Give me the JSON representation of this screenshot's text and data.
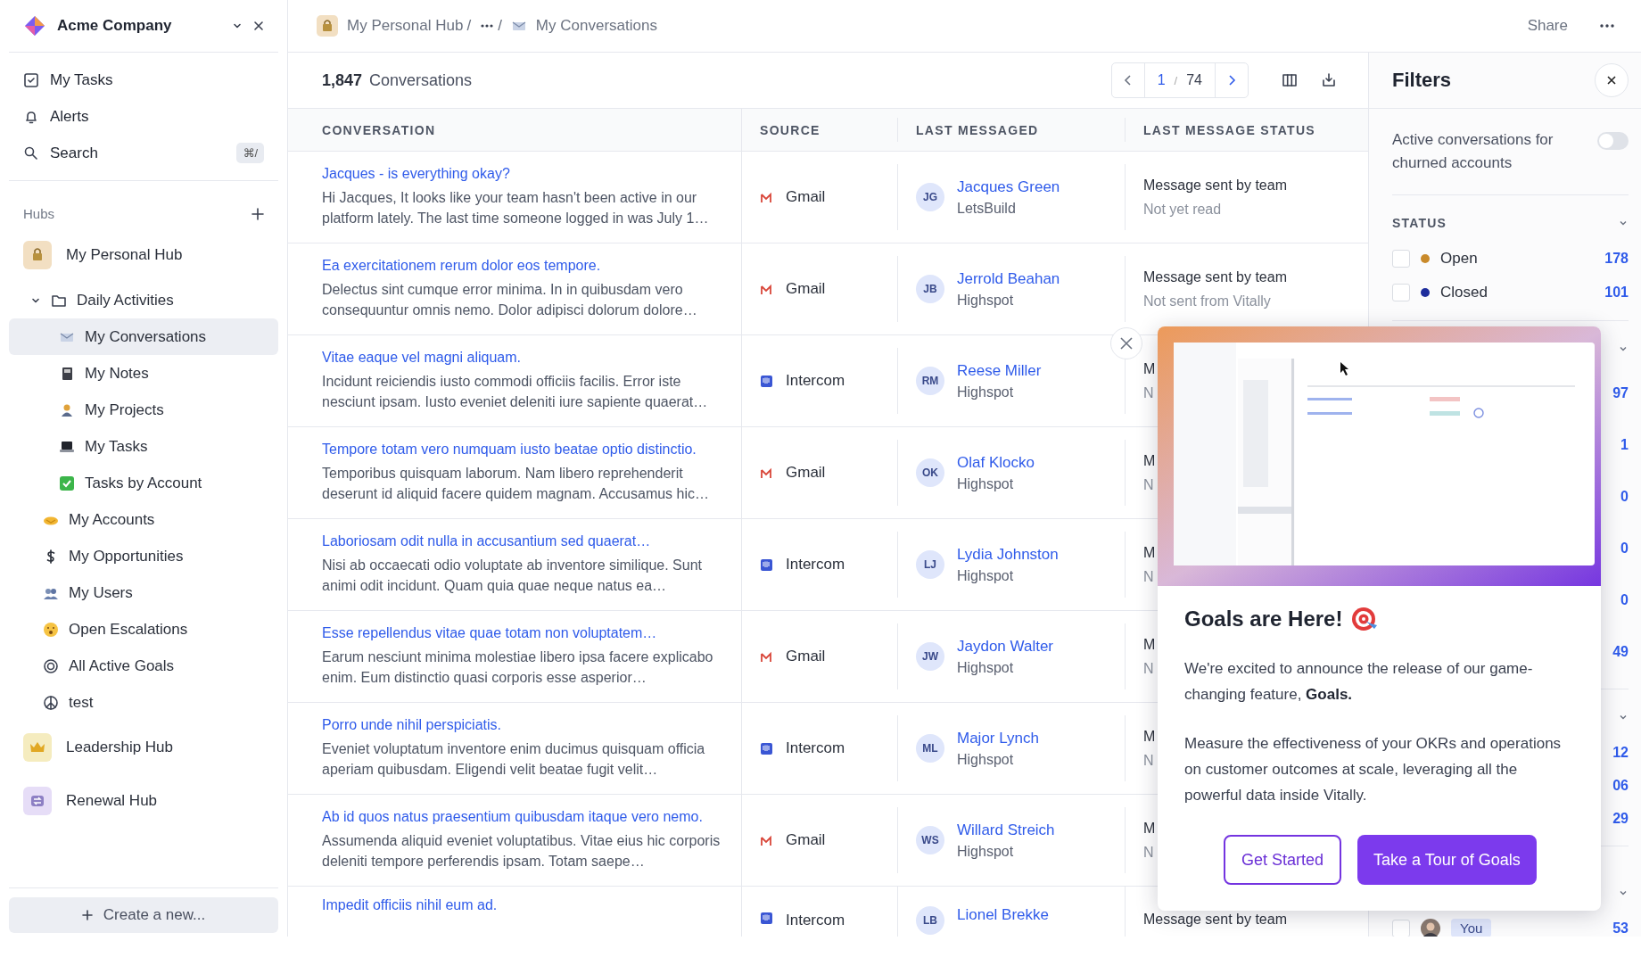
{
  "workspace": {
    "name": "Acme Company"
  },
  "nav": [
    {
      "label": "My Tasks"
    },
    {
      "label": "Alerts"
    },
    {
      "label": "Search",
      "shortcut": "⌘/"
    }
  ],
  "hubs_title": "Hubs",
  "tree": [
    {
      "kind": "hub",
      "label": "My Personal Hub",
      "color": "#f2dfc2",
      "selected": false,
      "children": [
        {
          "kind": "folder",
          "label": "Daily Activities",
          "expanded": true,
          "selected": false,
          "children": [
            {
              "kind": "view",
              "label": "My Conversations",
              "selected": true
            },
            {
              "kind": "view",
              "label": "My Notes",
              "selected": false
            },
            {
              "kind": "view",
              "label": "My Projects",
              "selected": false
            },
            {
              "kind": "view",
              "label": "My Tasks",
              "selected": false
            },
            {
              "kind": "view",
              "label": "Tasks by Account",
              "selected": false
            }
          ]
        },
        {
          "kind": "view",
          "label": "My Accounts",
          "selected": false
        },
        {
          "kind": "view",
          "label": "My Opportunities",
          "selected": false
        },
        {
          "kind": "view",
          "label": "My Users",
          "selected": false
        },
        {
          "kind": "view",
          "label": "Open Escalations",
          "selected": false
        },
        {
          "kind": "view",
          "label": "All Active Goals",
          "selected": false
        },
        {
          "kind": "view",
          "label": "test",
          "selected": false
        }
      ]
    },
    {
      "kind": "hub",
      "label": "Leadership Hub",
      "color": "#f5ecbf",
      "selected": false
    },
    {
      "kind": "hub",
      "label": "Renewal Hub",
      "color": "#e6ddf7",
      "selected": false
    }
  ],
  "create_button": {
    "label": "Create a new..."
  },
  "breadcrumb": [
    {
      "kind": "hub",
      "label": "My Personal Hub",
      "separator": "/"
    },
    {
      "kind": "ellipsis",
      "separator": "/"
    },
    {
      "kind": "view",
      "label": "My Conversations"
    }
  ],
  "share": "Share",
  "toolbar": {
    "count": "1,847",
    "count_label": "Conversations",
    "pagination": {
      "page": "1",
      "separator": "/",
      "total": "74"
    }
  },
  "table": {
    "columns": [
      "CONVERSATION",
      "SOURCE",
      "LAST MESSAGED",
      "LAST MESSAGE STATUS"
    ],
    "rows": [
      {
        "title": "Jacques - is everything okay?",
        "snippet": "Hi Jacques, It looks like your team hasn't been active in our platform lately. The last time someone logged in was July 1…",
        "source": {
          "kind": "gmail",
          "label": "Gmail"
        },
        "contact": {
          "initials": "JG",
          "name": "Jacques Green",
          "company": "LetsBuild"
        },
        "status": [
          "Message sent by team",
          "Not yet read"
        ]
      },
      {
        "title": "Ea exercitationem rerum dolor eos tempore.",
        "snippet": "Delectus sint cumque error minima. In in quibusdam vero consequuntur omnis nemo. Dolor adipisci dolorum dolore…",
        "source": {
          "kind": "gmail",
          "label": "Gmail"
        },
        "contact": {
          "initials": "JB",
          "name": "Jerrold Beahan",
          "company": "Highspot"
        },
        "status": [
          "Message sent by team",
          "Not sent from Vitally"
        ]
      },
      {
        "title": "Vitae eaque vel magni aliquam.",
        "snippet": "Incidunt reiciendis iusto commodi officiis facilis. Error iste nesciunt ipsam. Iusto eveniet deleniti iure sapiente quaerat…",
        "source": {
          "kind": "intercom",
          "label": "Intercom"
        },
        "contact": {
          "initials": "RM",
          "name": "Reese Miller",
          "company": "Highspot"
        },
        "status": [
          "M",
          "N"
        ]
      },
      {
        "title": "Tempore totam vero numquam iusto beatae optio distinctio.",
        "snippet": "Temporibus quisquam laborum. Nam libero reprehenderit deserunt id aliquid facere quidem magnam. Accusamus hic…",
        "source": {
          "kind": "gmail",
          "label": "Gmail"
        },
        "contact": {
          "initials": "OK",
          "name": "Olaf Klocko",
          "company": "Highspot"
        },
        "status": [
          "M",
          "N"
        ]
      },
      {
        "title": "Laboriosam odit nulla in accusantium sed quaerat…",
        "snippet": "Nisi ab occaecati odio voluptate ab inventore similique. Sunt animi odit incidunt. Quam quia quae neque natus ea…",
        "source": {
          "kind": "intercom",
          "label": "Intercom"
        },
        "contact": {
          "initials": "LJ",
          "name": "Lydia Johnston",
          "company": "Highspot"
        },
        "status": [
          "M",
          "N"
        ]
      },
      {
        "title": "Esse repellendus vitae quae totam non voluptatem…",
        "snippet": "Earum nesciunt minima molestiae libero ipsa facere explicabo enim. Eum distinctio quasi corporis esse asperior…",
        "source": {
          "kind": "gmail",
          "label": "Gmail"
        },
        "contact": {
          "initials": "JW",
          "name": "Jaydon Walter",
          "company": "Highspot"
        },
        "status": [
          "M",
          "N"
        ]
      },
      {
        "title": "Porro unde nihil perspiciatis.",
        "snippet": "Eveniet voluptatum inventore enim ducimus quisquam officia aperiam quibusdam. Eligendi velit beatae fugit velit…",
        "source": {
          "kind": "intercom",
          "label": "Intercom"
        },
        "contact": {
          "initials": "ML",
          "name": "Major Lynch",
          "company": "Highspot"
        },
        "status": [
          "M",
          "N"
        ]
      },
      {
        "title": "Ab id quos natus praesentium quibusdam itaque vero nemo.",
        "snippet": "Assumenda aliquid eveniet voluptatibus. Vitae eius hic corporis deleniti tempore perferendis ipsam. Totam saepe…",
        "source": {
          "kind": "gmail",
          "label": "Gmail"
        },
        "contact": {
          "initials": "WS",
          "name": "Willard Streich",
          "company": "Highspot"
        },
        "status": [
          "M",
          "N"
        ]
      },
      {
        "title": "Impedit officiis nihil eum ad.",
        "source": {
          "kind": "intercom",
          "label": "Intercom"
        },
        "contact": {
          "initials": "LB",
          "name": "Lionel Brekke"
        },
        "status": [
          "Message sent by team"
        ]
      }
    ]
  },
  "filters": {
    "title": "Filters",
    "toggle": {
      "label": "Active conversations for churned accounts",
      "on": false
    },
    "sections": [
      {
        "title": "STATUS",
        "expanded": true,
        "options": [
          {
            "label": "Open",
            "color": "#c98a2a",
            "count": "178",
            "checked": false
          },
          {
            "label": "Closed",
            "color": "#1e2d9c",
            "count": "101",
            "checked": false
          }
        ]
      },
      {
        "expanded": true,
        "options": [
          {
            "count": "97"
          },
          {
            "count": "1"
          },
          {
            "count": "0"
          },
          {
            "count": "0"
          },
          {
            "count": "0"
          },
          {
            "count": "49"
          }
        ]
      },
      {
        "expanded": true,
        "options": [
          {
            "count": "12"
          },
          {
            "count": "06"
          },
          {
            "count": "29"
          }
        ]
      },
      {
        "expanded": true,
        "options": [
          {
            "kind": "user",
            "tag": "You",
            "count": "53",
            "checked": false
          }
        ]
      }
    ]
  },
  "announcement": {
    "title": "Goals are Here!",
    "paragraphs": [
      "We're excited to announce the release of our game-changing feature, **Goals.**",
      "Measure the effectiveness of your OKRs and operations on customer outcomes at scale, leveraging all the powerful data inside Vitally."
    ],
    "buttons": [
      {
        "kind": "secondary",
        "label": "Get Started"
      },
      {
        "kind": "primary",
        "label": "Take a Tour of Goals"
      }
    ]
  }
}
